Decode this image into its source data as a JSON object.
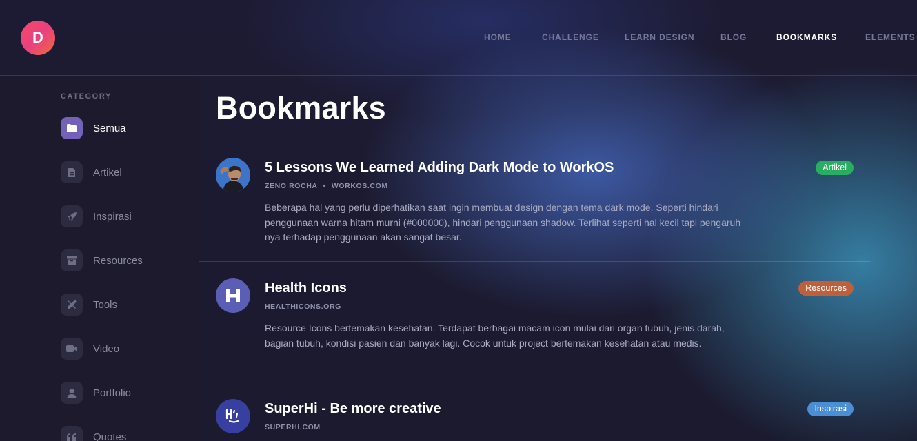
{
  "logo": {
    "letter": "D"
  },
  "nav": [
    {
      "label": "HOME",
      "active": false
    },
    {
      "label": "CHALLENGE",
      "active": false
    },
    {
      "label": "LEARN DESIGN",
      "active": false
    },
    {
      "label": "BLOG",
      "active": false
    },
    {
      "label": "BOOKMARKS",
      "active": true
    },
    {
      "label": "ELEMENTS",
      "active": false
    }
  ],
  "sidebar": {
    "title": "CATEGORY",
    "items": [
      {
        "label": "Semua",
        "icon": "folder-icon",
        "active": true
      },
      {
        "label": "Artikel",
        "icon": "document-icon",
        "active": false
      },
      {
        "label": "Inspirasi",
        "icon": "rocket-icon",
        "active": false
      },
      {
        "label": "Resources",
        "icon": "archive-icon",
        "active": false
      },
      {
        "label": "Tools",
        "icon": "tools-icon",
        "active": false
      },
      {
        "label": "Video",
        "icon": "video-icon",
        "active": false
      },
      {
        "label": "Portfolio",
        "icon": "user-icon",
        "active": false
      },
      {
        "label": "Quotes",
        "icon": "quote-icon",
        "active": false
      }
    ]
  },
  "main": {
    "title": "Bookmarks",
    "cards": [
      {
        "title": "5 Lessons We Learned Adding Dark Mode to WorkOS",
        "author": "ZENO ROCHA",
        "source": "WORKOS.COM",
        "description": "Beberapa hal yang perlu diperhatikan saat ingin membuat design dengan tema dark mode. Seperti hindari penggunaan warna hitam murni (#000000), hindari penggunaan shadow. Terlihat seperti hal kecil tapi pengaruh nya terhadap penggunaan akan sangat besar.",
        "badge": "Artikel",
        "badge_color": "#27ae60",
        "avatar": "person-avatar"
      },
      {
        "title": "Health Icons",
        "author": "",
        "source": "HEALTHICONS.ORG",
        "description": "Resource Icons bertemakan kesehatan. Terdapat berbagai macam icon mulai dari organ tubuh, jenis darah, bagian tubuh, kondisi pasien dan banyak lagi. Cocok untuk project bertemakan kesehatan atau medis.",
        "badge": "Resources",
        "badge_color": "#c0603a",
        "avatar": "health-icons-logo"
      },
      {
        "title": "SuperHi - Be more creative",
        "author": "",
        "source": "SUPERHI.COM",
        "description": "",
        "badge": "Inspirasi",
        "badge_color": "#4a8fd4",
        "avatar": "superhi-logo"
      }
    ]
  }
}
